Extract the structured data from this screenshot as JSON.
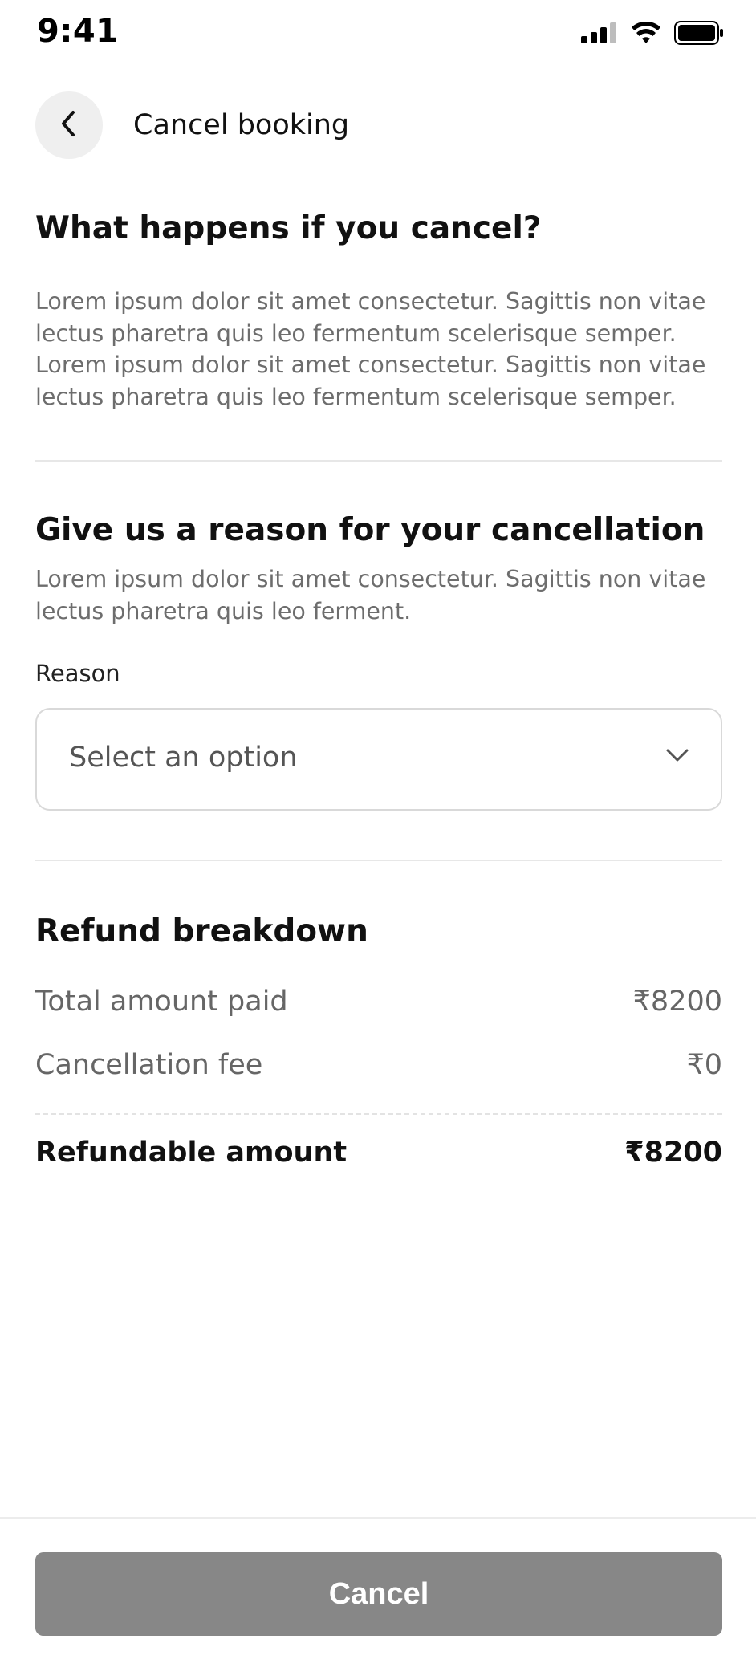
{
  "status_bar": {
    "time": "9:41",
    "icons": [
      "signal-icon",
      "wifi-icon",
      "battery-icon"
    ]
  },
  "header": {
    "back_icon": "chevron-left-icon",
    "title": "Cancel booking"
  },
  "what_happens": {
    "heading": "What happens if you cancel?",
    "body": "Lorem ipsum dolor sit amet consectetur. Sagittis non vitae lectus pharetra quis leo fermentum scelerisque semper. Lorem ipsum dolor sit amet consectetur. Sagittis non vitae lectus pharetra quis leo fermentum scelerisque semper."
  },
  "reason_section": {
    "heading": "Give us a reason for your cancellation",
    "body": "Lorem ipsum dolor sit amet consectetur. Sagittis non vitae lectus pharetra quis leo ferment.",
    "field_label": "Reason",
    "select_value": "Select an option",
    "select_icon": "chevron-down-icon"
  },
  "refund": {
    "heading": "Refund breakdown",
    "rows": [
      {
        "label": "Total amount paid",
        "value": "₹8200"
      },
      {
        "label": "Cancellation fee",
        "value": "₹0"
      }
    ],
    "total": {
      "label": "Refundable amount",
      "value": "₹8200"
    }
  },
  "footer": {
    "cancel_label": "Cancel"
  },
  "colors": {
    "primary_text": "#111111",
    "secondary_text": "#6d6d6d",
    "button_bg": "#878787",
    "back_button_bg": "#efefef",
    "divider": "#e7e7e7"
  }
}
